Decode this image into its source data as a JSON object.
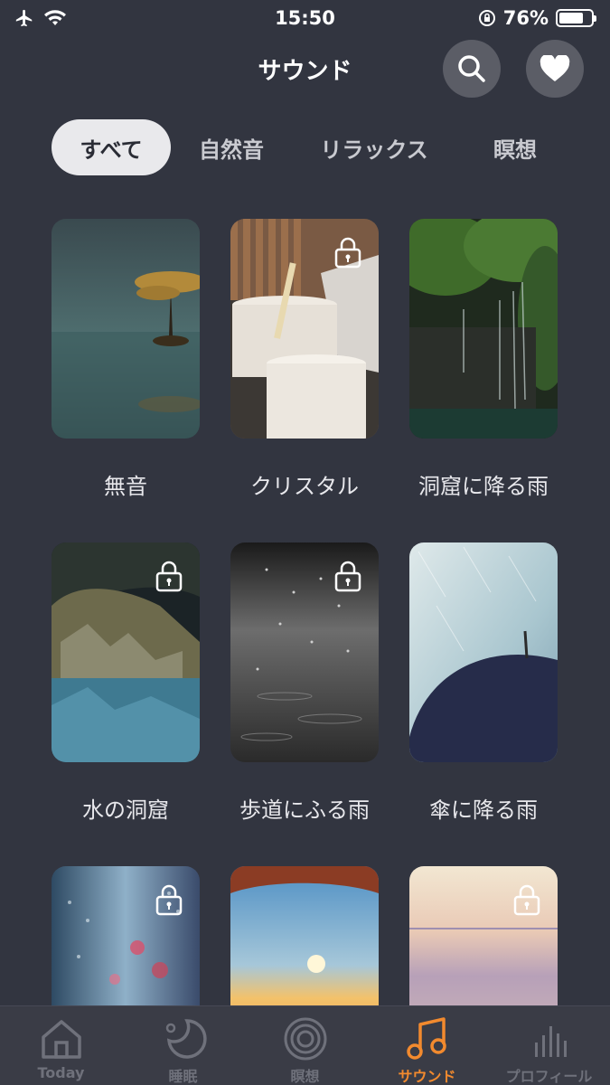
{
  "status_bar": {
    "time": "15:50",
    "battery": "76%",
    "battery_level": 0.76
  },
  "header": {
    "title": "サウンド",
    "search_icon": "search-icon",
    "favorite_icon": "heart-icon"
  },
  "tabs": [
    {
      "label": "すべて",
      "active": true
    },
    {
      "label": "自然音",
      "active": false
    },
    {
      "label": "リラックス",
      "active": false
    },
    {
      "label": "瞑想",
      "active": false
    }
  ],
  "sounds": [
    {
      "label": "無音",
      "locked": false
    },
    {
      "label": "クリスタル",
      "locked": true
    },
    {
      "label": "洞窟に降る雨",
      "locked": false
    },
    {
      "label": "水の洞窟",
      "locked": true
    },
    {
      "label": "歩道にふる雨",
      "locked": true
    },
    {
      "label": "傘に降る雨",
      "locked": false
    },
    {
      "label": "",
      "locked": true
    },
    {
      "label": "",
      "locked": false
    },
    {
      "label": "",
      "locked": true
    }
  ],
  "tabbar": [
    {
      "label": "Today",
      "icon": "home-icon",
      "active": false
    },
    {
      "label": "睡眠",
      "icon": "moon-icon",
      "active": false
    },
    {
      "label": "瞑想",
      "icon": "meditation-rings-icon",
      "active": false
    },
    {
      "label": "サウンド",
      "icon": "music-note-icon",
      "active": true
    },
    {
      "label": "プロフィール",
      "icon": "stats-bars-icon",
      "active": false
    }
  ],
  "colors": {
    "background": "#323540",
    "accent": "#f28a2e",
    "tab_active_bg": "#e9e9ec"
  }
}
